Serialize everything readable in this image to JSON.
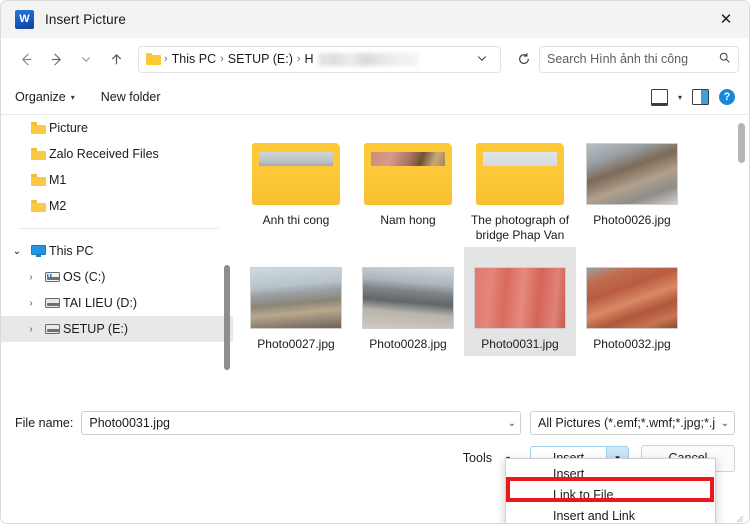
{
  "window": {
    "title": "Insert Picture",
    "app_icon": "word-icon",
    "app_icon_letter": "W",
    "close_label": "✕"
  },
  "nav": {
    "back_icon": "arrow-left-icon",
    "forward_icon": "arrow-right-icon",
    "recent_icon": "chevron-down-icon",
    "up_icon": "arrow-up-icon",
    "breadcrumb": {
      "folder_icon": "folder-icon",
      "items": [
        "This PC",
        "SETUP (E:)"
      ],
      "redacted_item": "H",
      "separator": "›",
      "dropdown_icon": "chevron-down-icon"
    },
    "refresh_icon": "refresh-icon",
    "search": {
      "placeholder": "Search Hình ảnh thi công",
      "icon": "search-icon"
    }
  },
  "commandbar": {
    "organize_label": "Organize",
    "organize_caret": "▾",
    "new_folder_label": "New folder",
    "view_icon": "view-layout-icon",
    "view_caret": "▾",
    "preview_pane_icon": "preview-pane-icon",
    "help_icon": "help-icon",
    "help_glyph": "?"
  },
  "sidebar": {
    "items": [
      {
        "label": "Picture",
        "icon": "folder-icon",
        "indent": 1,
        "chevron": "",
        "selected": false
      },
      {
        "label": "Zalo Received Files",
        "icon": "folder-icon",
        "indent": 1,
        "chevron": "",
        "selected": false
      },
      {
        "label": "M1",
        "icon": "folder-icon",
        "indent": 1,
        "chevron": "",
        "selected": false
      },
      {
        "label": "M2",
        "icon": "folder-icon",
        "indent": 1,
        "chevron": "",
        "selected": false
      }
    ],
    "tree": [
      {
        "label": "This PC",
        "icon": "this-pc-icon",
        "chevron": "⌄",
        "expanded": true,
        "selected": false
      },
      {
        "label": "OS (C:)",
        "icon": "os-drive-icon",
        "chevron": "›",
        "expanded": false,
        "selected": false
      },
      {
        "label": "TAI LIEU (D:)",
        "icon": "drive-icon",
        "chevron": "›",
        "expanded": false,
        "selected": false
      },
      {
        "label": "SETUP (E:)",
        "icon": "drive-icon",
        "chevron": "›",
        "expanded": false,
        "selected": true
      }
    ]
  },
  "files": [
    {
      "name": "Anh thi cong",
      "type": "folder",
      "selected": false,
      "thumb": "ph-a"
    },
    {
      "name": "Nam hong",
      "type": "folder",
      "selected": false,
      "thumb": "ph-b"
    },
    {
      "name": "The photograph of bridge Phap Van",
      "type": "folder",
      "selected": false,
      "thumb": "ph-c"
    },
    {
      "name": "Photo0026.jpg",
      "type": "image",
      "selected": false,
      "thumb": "ph-d"
    },
    {
      "name": "Photo0027.jpg",
      "type": "image",
      "selected": false,
      "thumb": "ph-e"
    },
    {
      "name": "Photo0028.jpg",
      "type": "image",
      "selected": false,
      "thumb": "ph-f"
    },
    {
      "name": "Photo0031.jpg",
      "type": "image",
      "selected": true,
      "thumb": "ph-g"
    },
    {
      "name": "Photo0032.jpg",
      "type": "image",
      "selected": false,
      "thumb": "ph-h"
    }
  ],
  "bottom": {
    "filename_label": "File name:",
    "filename_value": "Photo0031.jpg",
    "filename_chevron": "⌄",
    "filter_value": "All Pictures (*.emf;*.wmf;*.jpg;*.j",
    "filter_chevron": "⌄",
    "tools_label": "Tools",
    "tools_caret": "▾",
    "insert_label": "Insert",
    "insert_split_caret": "▾",
    "cancel_label": "Cancel"
  },
  "dropdown_menu": {
    "items": [
      {
        "label": "Insert",
        "highlighted": false
      },
      {
        "label": "Link to File",
        "highlighted": true
      },
      {
        "label": "Insert and Link",
        "highlighted": false
      }
    ],
    "highlight_color": "#e8181c"
  }
}
